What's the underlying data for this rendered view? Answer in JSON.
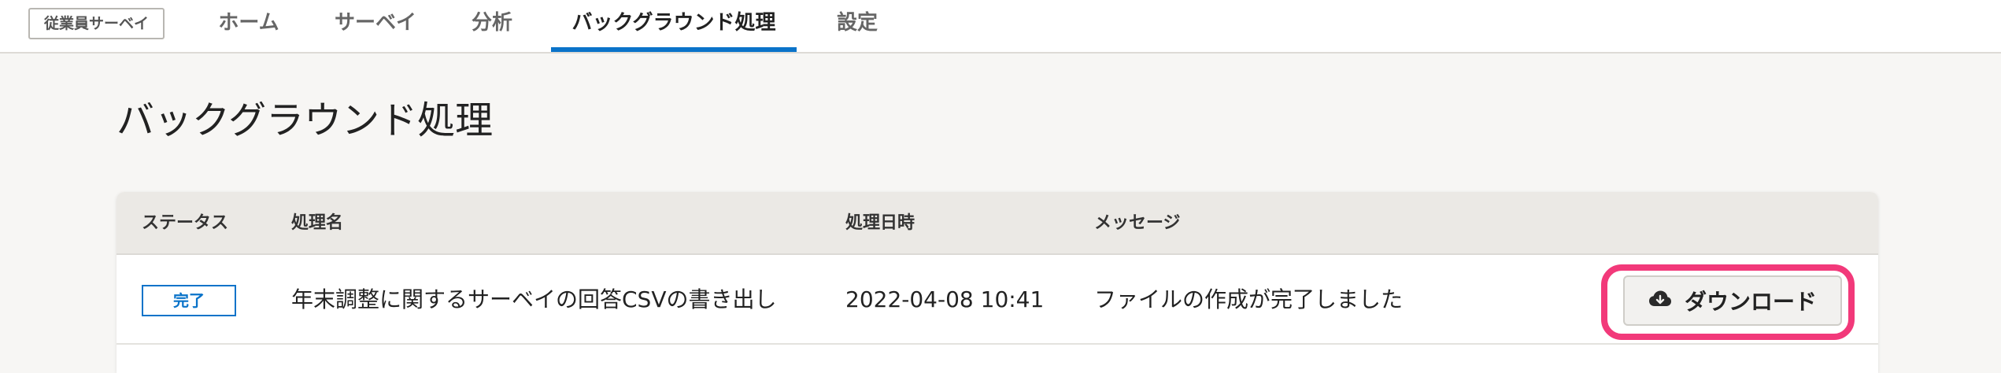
{
  "app": {
    "brand": "従業員サーベイ"
  },
  "nav": {
    "tabs": [
      {
        "label": "ホーム"
      },
      {
        "label": "サーベイ"
      },
      {
        "label": "分析"
      },
      {
        "label": "バックグラウンド処理",
        "active": true
      },
      {
        "label": "設定"
      }
    ]
  },
  "page": {
    "title": "バックグラウンド処理"
  },
  "table": {
    "columns": [
      "ステータス",
      "処理名",
      "処理日時",
      "メッセージ"
    ],
    "rows": [
      {
        "status": "完了",
        "name": "年末調整に関するサーベイの回答CSVの書き出し",
        "datetime": "2022-04-08 10:41",
        "message": "ファイルの作成が完了しました",
        "action_label": "ダウンロード"
      }
    ]
  },
  "colors": {
    "accent": "#0a73c9",
    "highlight": "#f2397a"
  },
  "icons": {
    "download": "cloud-download-icon"
  }
}
